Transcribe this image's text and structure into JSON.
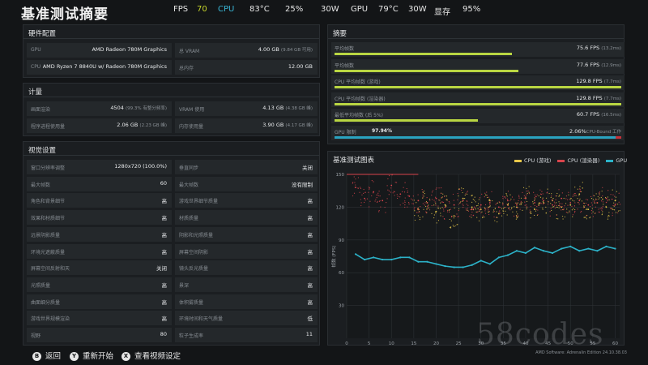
{
  "header": {
    "title": "基准测试摘要",
    "hud": {
      "fps_label": "FPS",
      "fps_value": "70",
      "cpu_label": "CPU",
      "cpu_temp": "83°C",
      "cpu_usage": "25%",
      "cpu_power": "30W",
      "gpu_label": "GPU",
      "gpu_temp": "79°C",
      "gpu_power": "30W",
      "vram_label": "显存",
      "vram_usage": "95%"
    }
  },
  "hardware": {
    "title": "硬件配置",
    "gpu_key": "GPU",
    "gpu_value": "AMD Radeon 780M Graphics",
    "vram_key": "总 VRAM",
    "vram_value": "4.00 GB",
    "vram_sub": "(9.84 GB 可用)",
    "cpu_key": "CPU",
    "cpu_value": "AMD Ryzen 7 8840U w/ Radeon 780M Graphics",
    "ram_key": "总内存",
    "ram_value": "12.00 GB"
  },
  "metrics": {
    "title": "计量",
    "frames_key": "画面渲染",
    "frames_value": "4504",
    "frames_sub": "(99.3% 有整分频率)",
    "vram_use_key": "VRAM 使用",
    "vram_use_value": "4.13 GB",
    "vram_use_sub": "(4.38 GB 峰)",
    "ram_proc_key": "程序进程使用量",
    "ram_proc_value": "2.06 GB",
    "ram_proc_sub": "(2.23 GB 峰)",
    "ram_use_key": "内存使用量",
    "ram_use_value": "3.90 GB",
    "ram_use_sub": "(4.17 GB 峰)"
  },
  "visual": {
    "title": "视觉设置",
    "left": [
      {
        "k": "窗口分辨率调整",
        "v": "1280x720 (100.0%)"
      },
      {
        "k": "最大帧数",
        "v": "60"
      },
      {
        "k": "角色和背景细节",
        "v": "高"
      },
      {
        "k": "效果和材质细节",
        "v": "高"
      },
      {
        "k": "远景阴影质量",
        "v": "高"
      },
      {
        "k": "环境光遮蔽质量",
        "v": "高"
      },
      {
        "k": "屏幕空间反射和天",
        "v": "关闭"
      },
      {
        "k": "光照质量",
        "v": "高"
      },
      {
        "k": "曲面细分质量",
        "v": "高"
      },
      {
        "k": "游戏世界规模渲染",
        "v": "高"
      },
      {
        "k": "视野",
        "v": "80"
      }
    ],
    "right": [
      {
        "k": "垂直同步",
        "v": "关闭"
      },
      {
        "k": "最大帧数",
        "v": "没有限制"
      },
      {
        "k": "游戏世界细节质量",
        "v": "高"
      },
      {
        "k": "材质质量",
        "v": "高"
      },
      {
        "k": "阴影和光照质量",
        "v": "高"
      },
      {
        "k": "屏幕空间阴影",
        "v": "高"
      },
      {
        "k": "镜头反光质量",
        "v": "高"
      },
      {
        "k": "景深",
        "v": "高"
      },
      {
        "k": "体积雾质量",
        "v": "高"
      },
      {
        "k": "环境时间和天气质量",
        "v": "低"
      },
      {
        "k": "粒子生成率",
        "v": "11"
      }
    ]
  },
  "summary": {
    "title": "摘要",
    "rows": [
      {
        "k": "平均帧数",
        "v": "75.6 FPS",
        "sub": "(13.2ms)",
        "pct": 0.62
      },
      {
        "k": "平均帧数",
        "v": "77.6 FPS",
        "sub": "(12.9ms)",
        "pct": 0.64
      },
      {
        "k": "CPU 平均帧数 (游戏)",
        "v": "129.8 FPS",
        "sub": "(7.7ms)",
        "pct": 1.0
      },
      {
        "k": "CPU 平均帧数 (渲染器)",
        "v": "129.8 FPS",
        "sub": "(7.7ms)",
        "pct": 1.0
      },
      {
        "k": "最低平均帧数 (后 5%)",
        "v": "60.7 FPS",
        "sub": "(16.5ms)",
        "pct": 0.5
      }
    ],
    "gpu_key": "GPU 限制",
    "gpu_value": "97.94%",
    "cpu_bound_value": "2.06%",
    "cpu_bound_label": "CPU-Bound 工作",
    "gpu_pct": 0.9794
  },
  "chart_panel": {
    "title": "基准测试图表",
    "legend": [
      {
        "label": "CPU (游戏)",
        "color": "#e8c84a"
      },
      {
        "label": "CPU (渲染器)",
        "color": "#d8444c"
      },
      {
        "label": "GPU",
        "color": "#2cb2c8"
      }
    ]
  },
  "chart_data": {
    "type": "scatter",
    "title": "基准测试图表",
    "xlabel": "时间 (秒)",
    "ylabel": "帧数 (FPS)",
    "xlim": [
      0,
      61
    ],
    "ylim": [
      0,
      150
    ],
    "xticks": [
      0,
      5,
      10,
      15,
      20,
      25,
      30,
      35,
      40,
      45,
      50,
      55,
      60
    ],
    "yticks": [
      30,
      60,
      90,
      120,
      150
    ],
    "grid": true,
    "legend_position": "top-right",
    "series": [
      {
        "name": "CPU (游戏)",
        "color": "#e8c84a",
        "x": [
          16,
          18,
          20,
          22,
          24,
          26,
          28,
          30,
          32,
          34,
          36,
          38,
          40,
          42,
          44,
          46,
          48,
          50,
          52,
          54,
          56,
          58,
          60
        ],
        "y": [
          118,
          124,
          116,
          122,
          112,
          128,
          120,
          118,
          126,
          114,
          122,
          120,
          128,
          118,
          124,
          126,
          120,
          122,
          132,
          118,
          124,
          120,
          126
        ]
      },
      {
        "name": "CPU (渲染器)",
        "color": "#d8444c",
        "x": [
          2,
          4,
          6,
          8,
          10,
          12,
          14,
          16,
          18,
          20,
          22,
          24,
          26,
          28,
          30,
          32,
          34,
          36,
          38,
          40,
          42,
          44,
          46,
          48,
          50,
          52,
          54,
          56,
          58,
          60
        ],
        "y": [
          138,
          128,
          134,
          126,
          140,
          132,
          130,
          126,
          124,
          128,
          120,
          122,
          126,
          118,
          122,
          124,
          120,
          126,
          122,
          128,
          124,
          126,
          122,
          128,
          124,
          126,
          122,
          124,
          128,
          122
        ]
      },
      {
        "name": "GPU",
        "color": "#2cb2c8",
        "x": [
          2,
          4,
          6,
          8,
          10,
          12,
          14,
          16,
          18,
          20,
          22,
          24,
          26,
          28,
          30,
          32,
          34,
          36,
          38,
          40,
          42,
          44,
          46,
          48,
          50,
          52,
          54,
          56,
          58,
          60
        ],
        "y": [
          77,
          72,
          74,
          72,
          72,
          74,
          74,
          70,
          70,
          68,
          66,
          65,
          65,
          67,
          71,
          68,
          74,
          76,
          80,
          78,
          83,
          80,
          78,
          82,
          84,
          80,
          82,
          80,
          84,
          82
        ]
      }
    ],
    "hline": {
      "y": 150,
      "color": "#d8444c",
      "x_end": 16
    }
  },
  "footer": {
    "back_glyph": "B",
    "back_label": "返回",
    "restart_glyph": "Y",
    "restart_label": "重新开始",
    "video_glyph": "X",
    "video_label": "查看视频设定",
    "version": "AMD Software: Adrenalin Edition 24.10.38.03"
  },
  "watermark": "58codes"
}
